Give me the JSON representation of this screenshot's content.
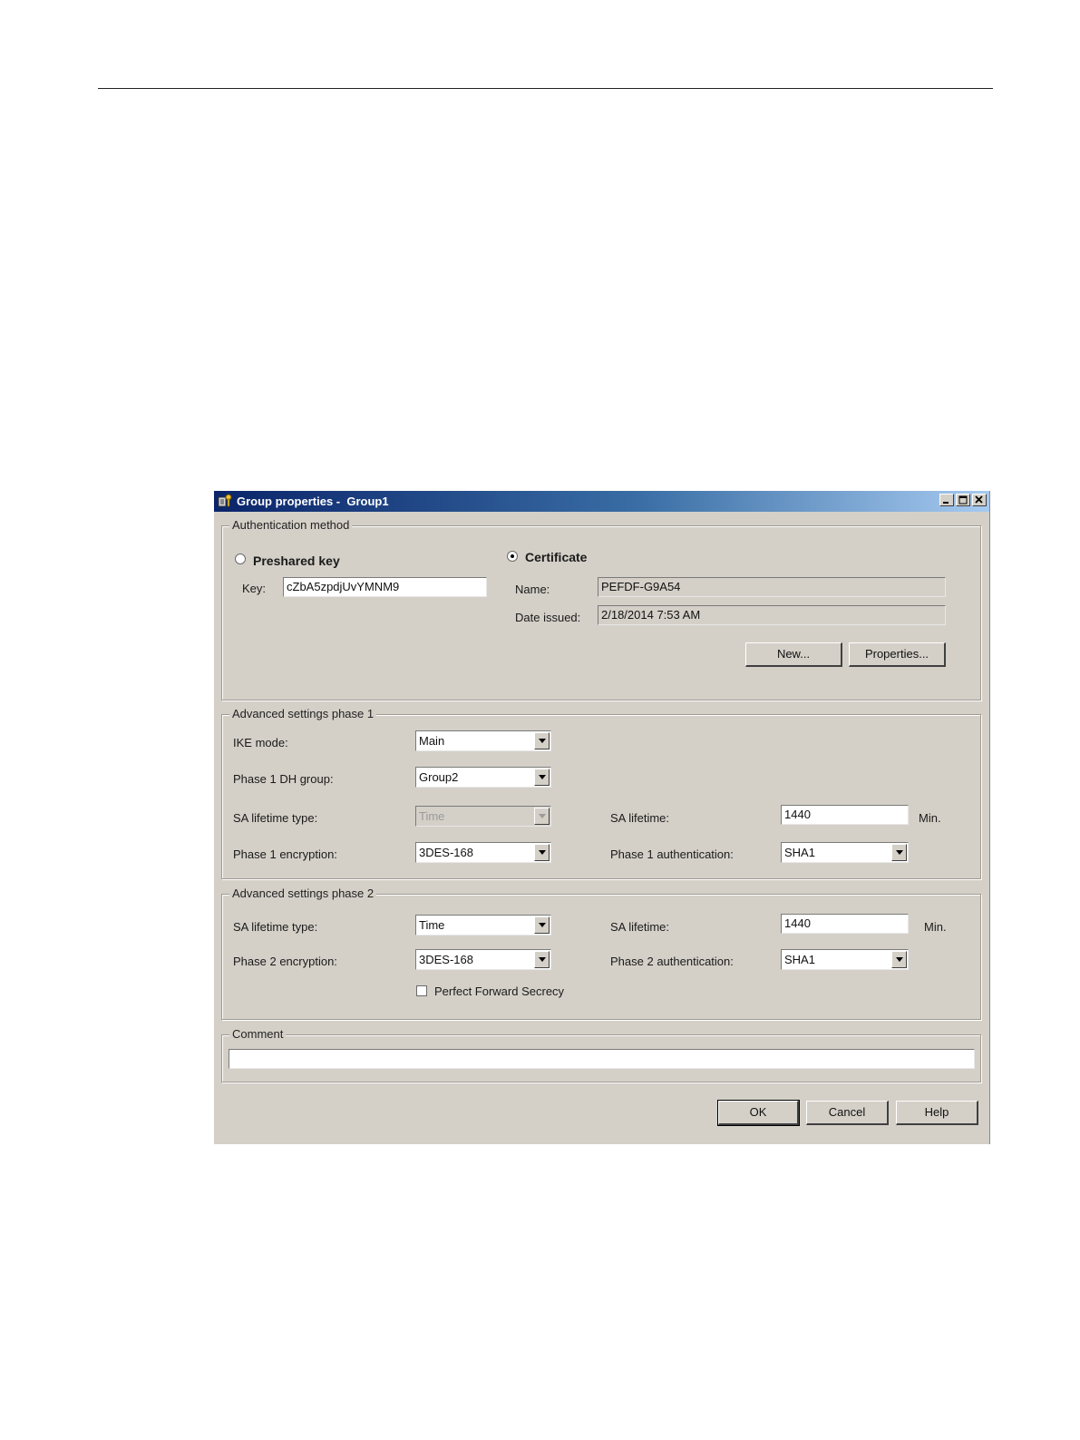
{
  "window": {
    "title": "Group properties -  Group1"
  },
  "auth": {
    "legend": "Authentication method",
    "preshared_label": "Preshared key",
    "preshared_selected": false,
    "key_label": "Key:",
    "key_value": "cZbA5zpdjUvYMNM9",
    "certificate_label": "Certificate",
    "certificate_selected": true,
    "name_label": "Name:",
    "name_value": "PEFDF-G9A54",
    "date_label": "Date issued:",
    "date_value": "2/18/2014 7:53 AM",
    "new_button": "New...",
    "properties_button": "Properties..."
  },
  "phase1": {
    "legend": "Advanced settings phase 1",
    "ike_label": "IKE mode:",
    "ike_value": "Main",
    "dh_label": "Phase 1 DH group:",
    "dh_value": "Group2",
    "sa_type_label": "SA lifetime type:",
    "sa_type_value": "Time",
    "sa_lifetime_label": "SA lifetime:",
    "sa_lifetime_value": "1440",
    "sa_unit": "Min.",
    "enc_label": "Phase 1 encryption:",
    "enc_value": "3DES-168",
    "auth_label": "Phase 1 authentication:",
    "auth_value": "SHA1"
  },
  "phase2": {
    "legend": "Advanced settings phase 2",
    "sa_type_label": "SA lifetime type:",
    "sa_type_value": "Time",
    "sa_lifetime_label": "SA lifetime:",
    "sa_lifetime_value": "1440",
    "sa_unit": "Min.",
    "enc_label": "Phase 2 encryption:",
    "enc_value": "3DES-168",
    "auth_label": "Phase 2 authentication:",
    "auth_value": "SHA1",
    "pfs_label": "Perfect Forward Secrecy",
    "pfs_checked": false
  },
  "comment": {
    "legend": "Comment",
    "value": ""
  },
  "footer": {
    "ok": "OK",
    "cancel": "Cancel",
    "help": "Help"
  }
}
